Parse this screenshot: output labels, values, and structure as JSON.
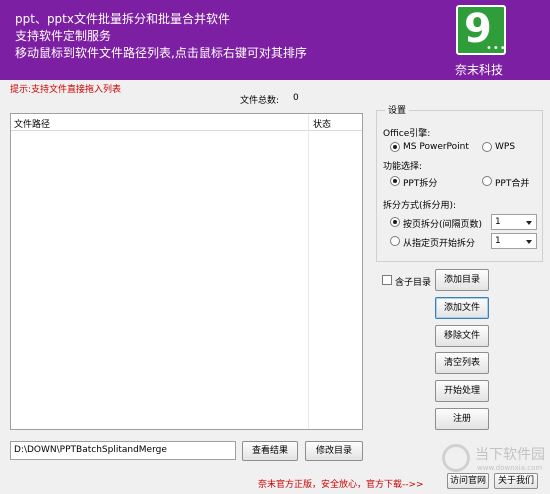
{
  "banner": {
    "line1": "ppt、pptx文件批量拆分和批量合并软件",
    "line2": "支持软件定制服务",
    "line3": "移动鼠标到软件文件路径列表,点击鼠标右键可对其排序",
    "logo_text": "9",
    "brand": "奈末科技",
    "colors": {
      "banner_bg": "#7c1fa2",
      "logo_bg": "#2e9d3a"
    }
  },
  "hint": "提示:支持文件直接拖入列表",
  "file_count": {
    "label": "文件总数:",
    "value": "0"
  },
  "file_list": {
    "columns": [
      "文件路径",
      "状态"
    ],
    "rows": []
  },
  "output_path": "D:\\DOWN\\PPTBatchSplitandMerge",
  "buttons": {
    "view_result": "查看结果",
    "modify_dir": "修改目录",
    "add_dir": "添加目录",
    "add_file": "添加文件",
    "remove_file": "移除文件",
    "clear_list": "清空列表",
    "start": "开始处理",
    "register": "注册",
    "official_site": "访问官网",
    "about": "关于我们"
  },
  "settings": {
    "title": "设置",
    "engine_label": "Office引擎:",
    "engine_options": [
      {
        "label": "MS PowerPoint",
        "selected": true
      },
      {
        "label": "WPS",
        "selected": false
      }
    ],
    "function_label": "功能选择:",
    "function_options": [
      {
        "label": "PPT拆分",
        "selected": true
      },
      {
        "label": "PPT合并",
        "selected": false
      }
    ],
    "split_label": "拆分方式(拆分用):",
    "split_options": [
      {
        "label": "按页拆分(间隔页数)",
        "selected": true,
        "value": "1"
      },
      {
        "label": "从指定页开始拆分",
        "selected": false,
        "value": "1"
      }
    ]
  },
  "include_subdir": {
    "label": "含子目录",
    "checked": false
  },
  "footer": {
    "notice": "奈末官方正版，安全放心，官方下载-->>"
  },
  "watermark": {
    "text": "当下软件园",
    "url": "www.downxia.com"
  }
}
